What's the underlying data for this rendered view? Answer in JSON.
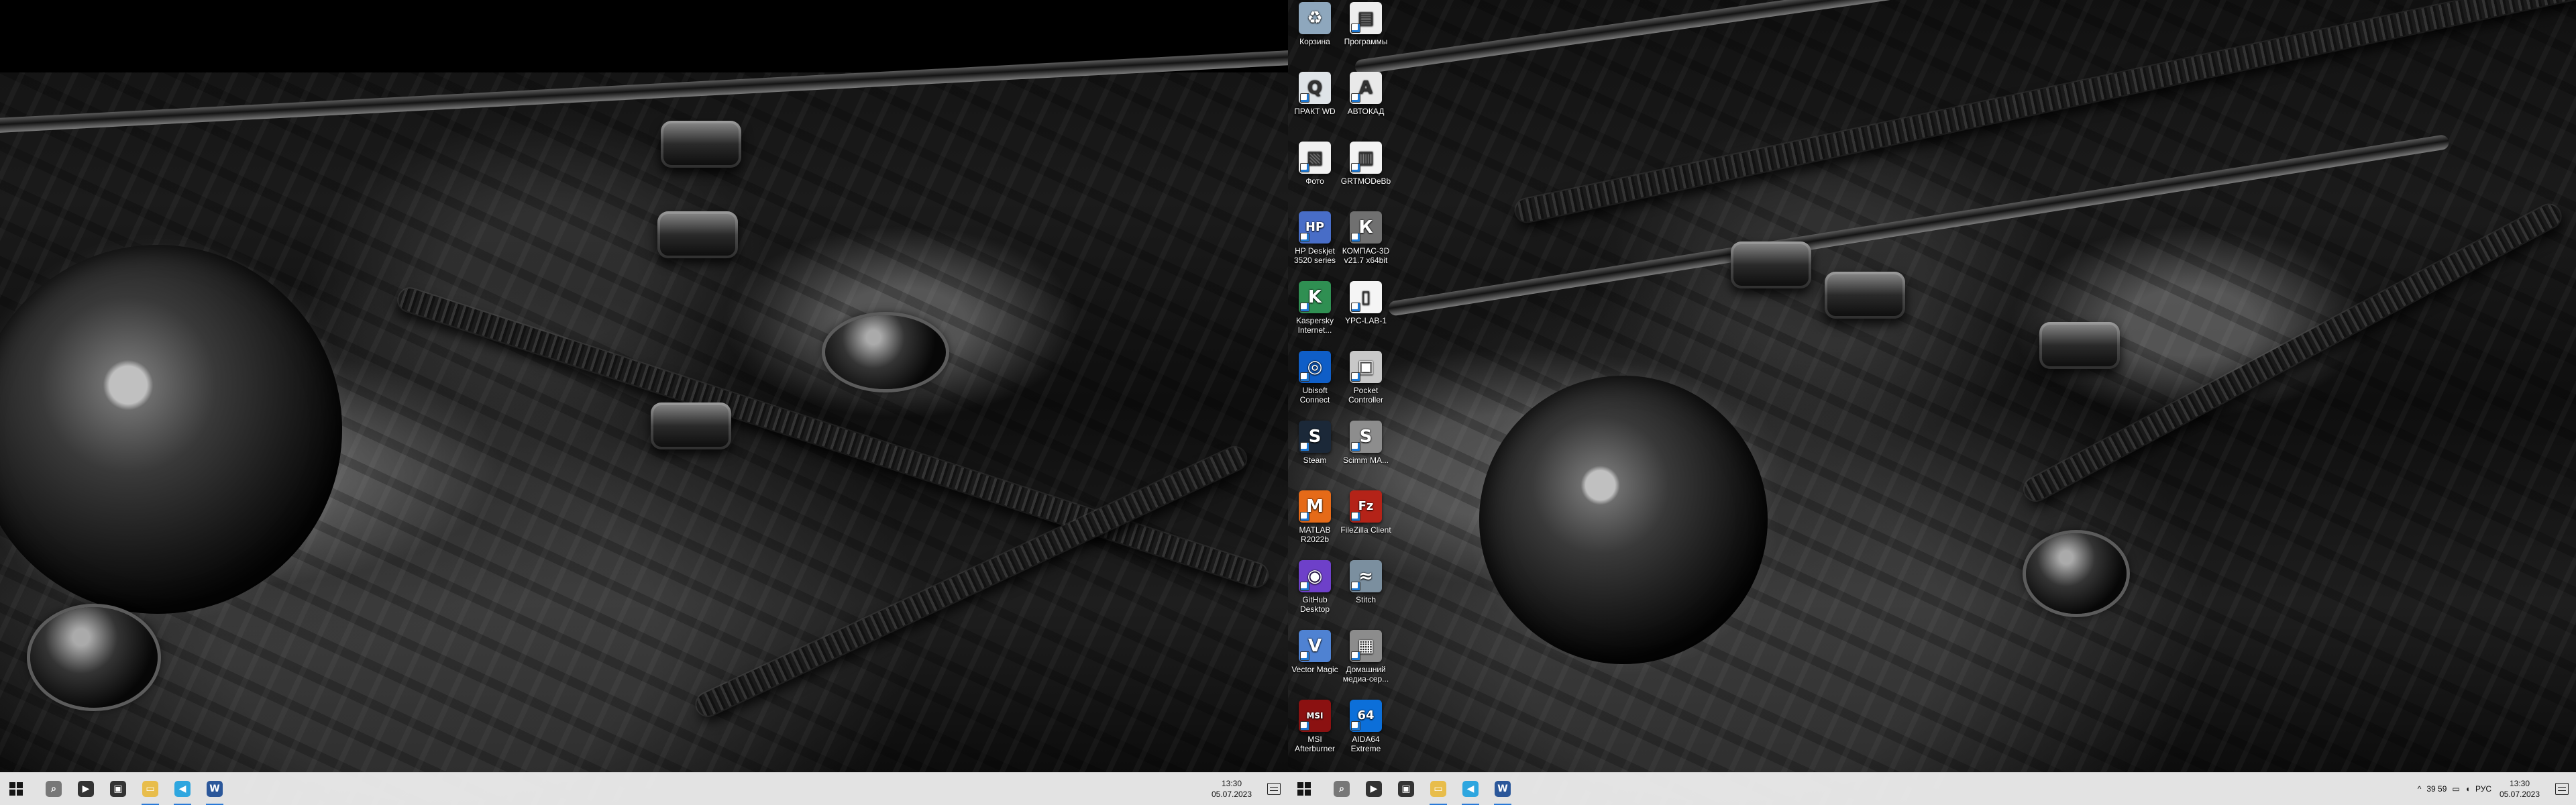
{
  "desktop": {
    "icons": [
      {
        "label": "Корзина",
        "glyph": "♻",
        "icon": "recycle-bin-icon",
        "color": "#8ea7bd"
      },
      {
        "label": "Программы",
        "glyph": "▤",
        "icon": "programs-folder-icon",
        "color": "#eeeeee"
      },
      {
        "label": "ПРАКТ WD",
        "glyph": "Q",
        "icon": "document-search-icon",
        "color": "#dfe4e8"
      },
      {
        "label": "АВТОКАД",
        "glyph": "A",
        "icon": "autocad-icon",
        "color": "#e9e9e9"
      },
      {
        "label": "Фото",
        "glyph": "▧",
        "icon": "photo-folder-icon",
        "color": "#f1f1f1"
      },
      {
        "label": "GRTMODeBb",
        "glyph": "▥",
        "icon": "file-icon",
        "color": "#f3f3f3"
      },
      {
        "label": "HP Deskjet 3520 series",
        "glyph": "HP",
        "icon": "printer-icon",
        "color": "#486dc7"
      },
      {
        "label": "КОМПАС-3D v21.7 x64bit",
        "glyph": "К",
        "icon": "kompas-3d-icon",
        "color": "#707070"
      },
      {
        "label": "Kaspersky Internet...",
        "glyph": "K",
        "icon": "kaspersky-icon",
        "color": "#2f8f52"
      },
      {
        "label": "YPC-LAB-1",
        "glyph": "▯",
        "icon": "document-icon",
        "color": "#f5f5f5"
      },
      {
        "label": "Ubisoft Connect",
        "glyph": "◎",
        "icon": "ubisoft-connect-icon",
        "color": "#0f5ec7"
      },
      {
        "label": "Pocket Controller",
        "glyph": "▣",
        "icon": "pocket-controller-icon",
        "color": "#c8c8c8"
      },
      {
        "label": "Steam",
        "glyph": "S",
        "icon": "steam-icon",
        "color": "#1b2838"
      },
      {
        "label": "Scimm MA...",
        "glyph": "S",
        "icon": "app-icon",
        "color": "#8d8d8d"
      },
      {
        "label": "MATLAB R2022b",
        "glyph": "M",
        "icon": "matlab-icon",
        "color": "#e56a18"
      },
      {
        "label": "FileZilla Client",
        "glyph": "Fz",
        "icon": "filezilla-icon",
        "color": "#b42318"
      },
      {
        "label": "GitHub Desktop",
        "glyph": "◉",
        "icon": "github-desktop-icon",
        "color": "#6e40c9"
      },
      {
        "label": "Stitch",
        "glyph": "≈",
        "icon": "stitch-icon",
        "color": "#7b8f9f"
      },
      {
        "label": "Vector Magic",
        "glyph": "V",
        "icon": "vector-magic-icon",
        "color": "#4f82d2"
      },
      {
        "label": "Домашний медиа-сер...",
        "glyph": "▦",
        "icon": "home-media-server-icon",
        "color": "#8c8c8c"
      },
      {
        "label": "MSI Afterburner",
        "glyph": "MSI",
        "icon": "msi-afterburner-icon",
        "color": "#8b1111"
      },
      {
        "label": "AIDA64 Extreme",
        "glyph": "64",
        "icon": "aida64-icon",
        "color": "#0c6fd9"
      }
    ]
  },
  "taskbars": {
    "left": {
      "apps": [
        {
          "glyph": "⌕",
          "icon": "task-view-icon",
          "color": "#777777"
        },
        {
          "glyph": "▶",
          "icon": "media-player-icon",
          "color": "#333333"
        },
        {
          "glyph": "▣",
          "icon": "app-window-icon",
          "color": "#333333"
        },
        {
          "glyph": "▭",
          "icon": "file-explorer-icon",
          "color": "#e8bd4b"
        },
        {
          "glyph": "◀",
          "icon": "telegram-icon",
          "color": "#2ea6df"
        },
        {
          "glyph": "W",
          "icon": "word-icon",
          "color": "#2b579a"
        }
      ],
      "clock": {
        "time": "13:30",
        "date": "05.07.2023"
      }
    },
    "right": {
      "apps": [
        {
          "glyph": "⌕",
          "icon": "task-view-icon",
          "color": "#777777"
        },
        {
          "glyph": "▶",
          "icon": "media-player-icon",
          "color": "#333333"
        },
        {
          "glyph": "▣",
          "icon": "app-window-icon",
          "color": "#333333"
        },
        {
          "glyph": "▭",
          "icon": "file-explorer-icon",
          "color": "#e8bd4b"
        },
        {
          "glyph": "◀",
          "icon": "telegram-icon",
          "color": "#2ea6df"
        },
        {
          "glyph": "W",
          "icon": "word-icon",
          "color": "#2b579a"
        }
      ],
      "tray": {
        "chevron": "^",
        "temps": "39 59",
        "language": "РУС"
      },
      "clock": {
        "time": "13:30",
        "date": "05.07.2023"
      }
    }
  }
}
